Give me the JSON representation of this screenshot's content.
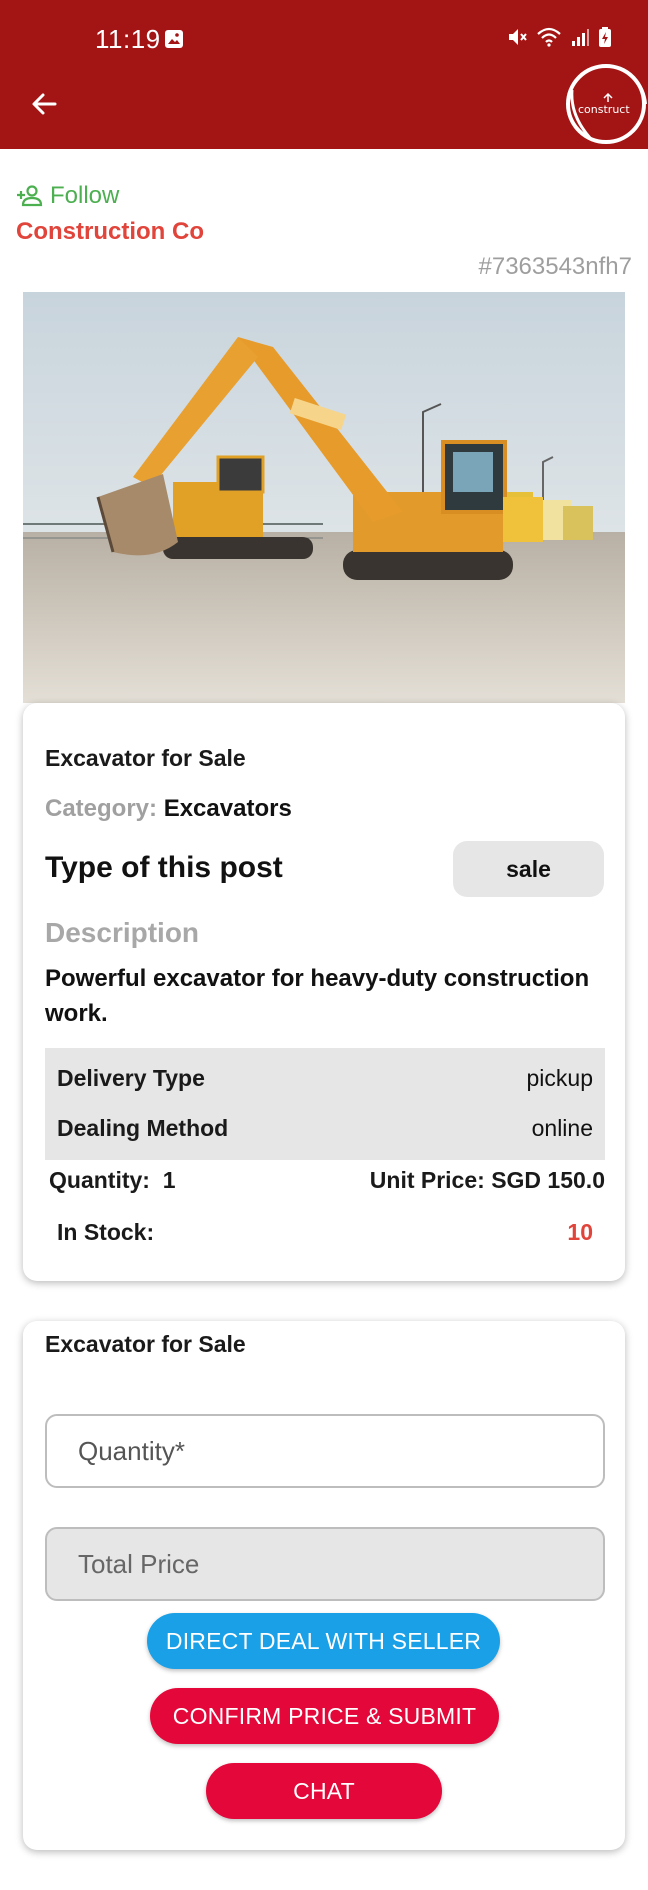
{
  "status_bar": {
    "time": "11:19",
    "icons": [
      "gallery-icon",
      "mute-icon",
      "wifi-icon",
      "signal-icon",
      "battery-icon"
    ]
  },
  "toolbar": {
    "back_icon": "arrow-left-icon",
    "logo_text": "construct"
  },
  "seller": {
    "follow_label": "Follow",
    "name": "Construction Co",
    "post_id": "#7363543nfh7"
  },
  "post": {
    "title": "Excavator for Sale",
    "category_label": "Category:",
    "category_value": "Excavators",
    "type_title": "Type of this post",
    "type_badge": "sale",
    "description_title": "Description",
    "description": "Powerful excavator for heavy-duty construction work.",
    "delivery_label": "Delivery Type",
    "delivery_value": "pickup",
    "dealing_label": "Dealing Method",
    "dealing_value": "online",
    "quantity_label": "Quantity:",
    "quantity_value": "1",
    "unit_price_label": "Unit Price:",
    "unit_price_value": "SGD 150.0",
    "stock_label": "In Stock:",
    "stock_value": "10"
  },
  "order": {
    "title": "Excavator for Sale",
    "quantity_placeholder": "Quantity*",
    "total_placeholder": "Total Price",
    "direct_deal_button": "DIRECT DEAL WITH SELLER",
    "confirm_button": "CONFIRM PRICE & SUBMIT",
    "chat_button": "CHAT"
  },
  "colors": {
    "appbar": "#a31515",
    "follow": "#4caf50",
    "seller_name": "#e0443a",
    "stock_value": "#e0443a",
    "direct_deal_button": "#1aa0e6",
    "confirm_button": "#e4083a",
    "chat_button": "#e4083a"
  }
}
